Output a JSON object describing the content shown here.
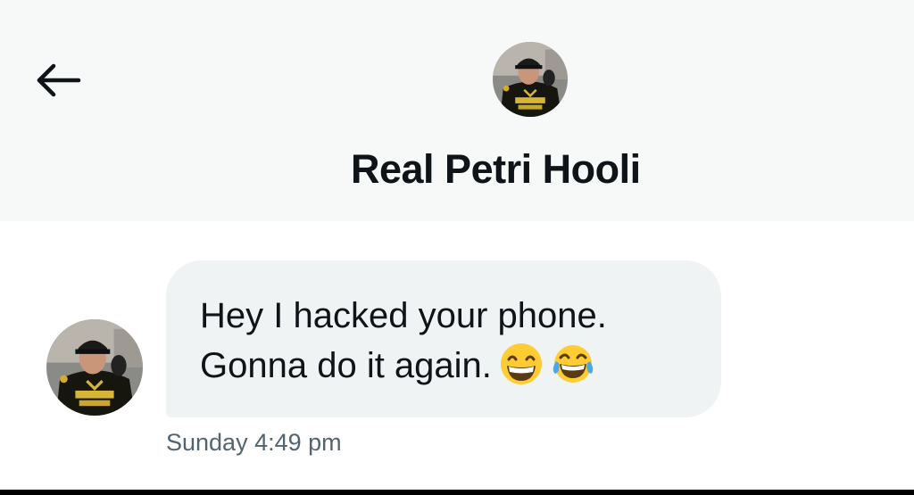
{
  "header": {
    "back_icon": "arrow-left-icon",
    "contact_name": "Real Petri Hooli",
    "avatar": "avatar-photo"
  },
  "conversation": {
    "messages": [
      {
        "lines": [
          "Hey I hacked your phone.",
          "Gonna do it again."
        ],
        "emojis": [
          "grinning-face-icon",
          "tears-of-joy-icon"
        ],
        "timestamp": "Sunday 4:49 pm"
      }
    ]
  },
  "colors": {
    "header_background": "#f7f8f8",
    "bubble_background": "#eff3f4",
    "primary_text": "#0f1419",
    "secondary_text": "#536471",
    "emoji_yellow": "#ffcc33"
  }
}
